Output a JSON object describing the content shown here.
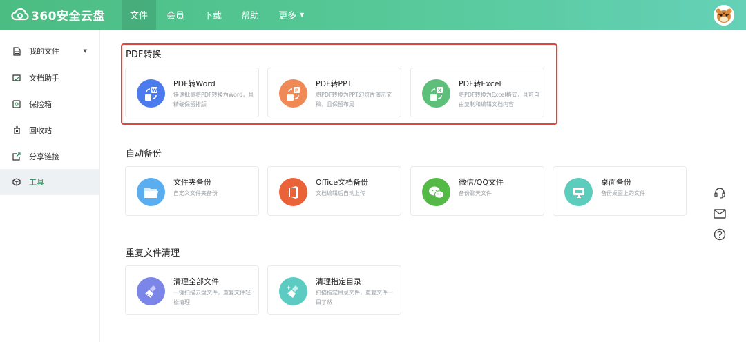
{
  "app": {
    "logo_text": "360安全云盘"
  },
  "nav": {
    "items": [
      {
        "label": "文件"
      },
      {
        "label": "会员"
      },
      {
        "label": "下载"
      },
      {
        "label": "帮助"
      },
      {
        "label": "更多"
      }
    ]
  },
  "sidebar": {
    "items": [
      {
        "label": "我的文件",
        "icon": "file-icon"
      },
      {
        "label": "文档助手",
        "icon": "document-assistant-icon"
      },
      {
        "label": "保险箱",
        "icon": "safe-icon"
      },
      {
        "label": "回收站",
        "icon": "trash-icon"
      },
      {
        "label": "分享链接",
        "icon": "share-icon"
      },
      {
        "label": "工具",
        "icon": "tools-icon"
      }
    ]
  },
  "sections": {
    "pdf": {
      "title": "PDF转换",
      "cards": [
        {
          "title": "PDF转Word",
          "desc": "快速批量将PDF转换为Word，且精确保留排版",
          "icon": "pdf-to-word-icon",
          "color": "#4b7bec"
        },
        {
          "title": "PDF转PPT",
          "desc": "将PDF转换为PPT幻灯片演示文稿，且保留布局",
          "icon": "pdf-to-ppt-icon",
          "color": "#ef8a57"
        },
        {
          "title": "PDF转Excel",
          "desc": "将PDF转换为Excel格式，且可自由复制和编辑文档内容",
          "icon": "pdf-to-excel-icon",
          "color": "#5dbf7a"
        }
      ]
    },
    "backup": {
      "title": "自动备份",
      "cards": [
        {
          "title": "文件夹备份",
          "desc": "自定义文件夹备份",
          "icon": "folder-icon",
          "color": "#5aaef0"
        },
        {
          "title": "Office文档备份",
          "desc": "文档编辑后自动上传",
          "icon": "office-icon",
          "color": "#ea6237"
        },
        {
          "title": "微信/QQ文件",
          "desc": "备份聊天文件",
          "icon": "wechat-icon",
          "color": "#55b947"
        },
        {
          "title": "桌面备份",
          "desc": "备份桌面上的文件",
          "icon": "desktop-icon",
          "color": "#5ccdbd"
        }
      ]
    },
    "cleanup": {
      "title": "重复文件清理",
      "cards": [
        {
          "title": "清理全部文件",
          "desc": "一键扫描云盘文件，重复文件轻松清理",
          "icon": "broom-icon",
          "color": "#7b86e8"
        },
        {
          "title": "清理指定目录",
          "desc": "扫描指定目录文件，重复文件一目了然",
          "icon": "broom-star-icon",
          "color": "#5ccbc2"
        }
      ]
    }
  }
}
